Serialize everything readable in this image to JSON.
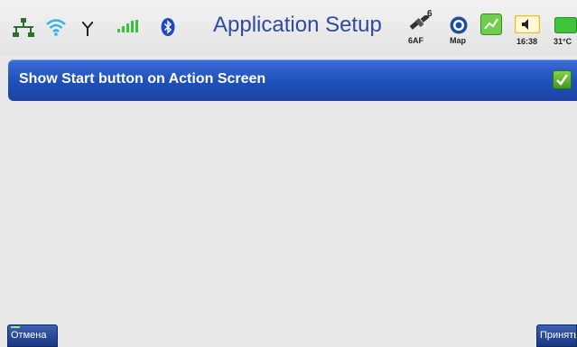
{
  "status_bar": {
    "title": "Application Setup",
    "satellite_count": "6",
    "satellite_label": "6AF",
    "map_label": "Map",
    "time": "16:38",
    "temperature": "31°C",
    "icons": [
      "network-icon",
      "wifi-icon",
      "antenna-icon",
      "signal-bars-icon",
      "bluetooth-icon",
      "satellite-icon",
      "map-icon",
      "route-icon",
      "volume-icon",
      "battery-icon"
    ]
  },
  "setting": {
    "label": "Show Start button on Action Screen",
    "checked": true
  },
  "softkeys": {
    "cancel_label": "Отмена",
    "accept_label": "Принять"
  },
  "colors": {
    "accent": "#1f4fb8",
    "title": "#2f4aa3",
    "checkbox": "#5cb52c"
  }
}
